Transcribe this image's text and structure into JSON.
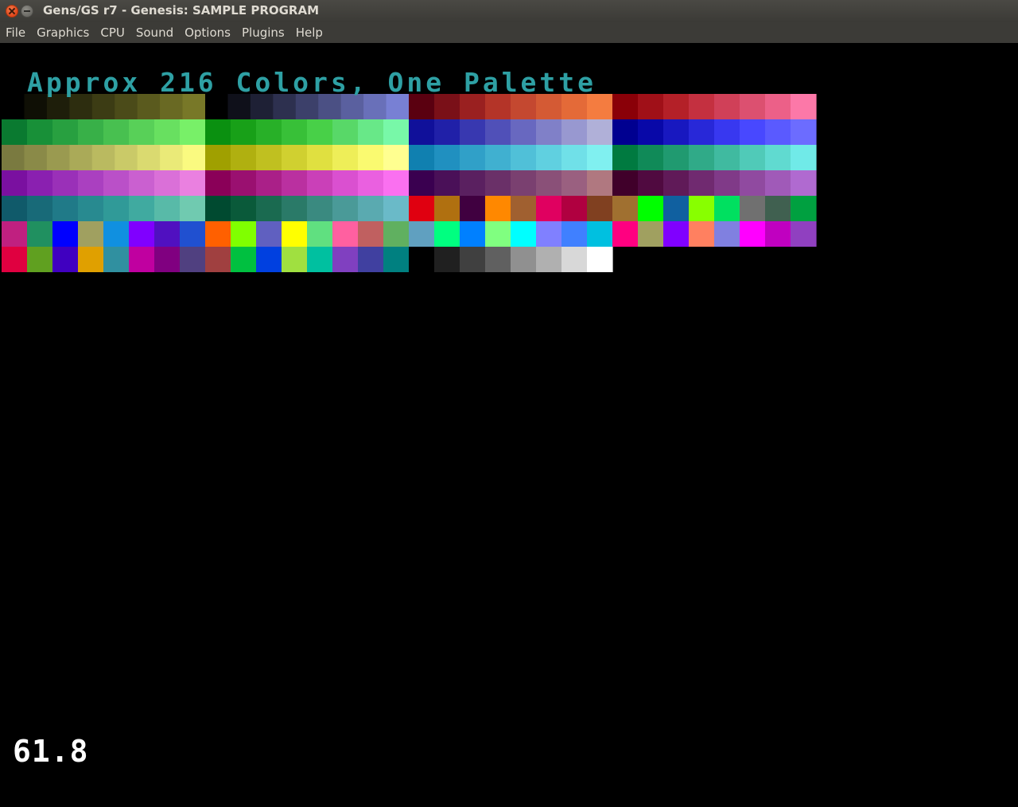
{
  "window": {
    "title": "Gens/GS r7 - Genesis: SAMPLE PROGRAM"
  },
  "menu": {
    "items": [
      "File",
      "Graphics",
      "CPU",
      "Sound",
      "Options",
      "Plugins",
      "Help"
    ]
  },
  "screen": {
    "heading": "Approx 216 Colors, One Palette",
    "fps": "61.8"
  },
  "colors": {
    "heading": "#2ea0a4",
    "background": "#000000",
    "fps": "#ffffff"
  },
  "palette_rows": [
    [
      [
        "#000000",
        "#0f0f05",
        "#1e1e0a",
        "#2d2d0f",
        "#3c3c14",
        "#4b4b19",
        "#5a5a1e",
        "#696923",
        "#787828"
      ],
      [
        "#000000",
        "#0f101a",
        "#1e2035",
        "#2d304f",
        "#3c406a",
        "#4b5084",
        "#5a609f",
        "#6970b9",
        "#7880d4"
      ],
      [
        "#5a0010",
        "#7a1018",
        "#9a2020",
        "#b43428",
        "#c44830",
        "#d45a34",
        "#e46a38",
        "#f47c40"
      ],
      [
        "#8a0008",
        "#a01018",
        "#b42028",
        "#c43040",
        "#d04058",
        "#dc5070",
        "#ec6088",
        "#fc78a8"
      ]
    ],
    [
      [
        "#0a7a30",
        "#189038",
        "#28a040",
        "#38b048",
        "#48c050",
        "#58d058",
        "#68e060",
        "#78f068"
      ],
      [
        "#0a9010",
        "#18a018",
        "#28b028",
        "#38c038",
        "#48d048",
        "#58d868",
        "#68e888",
        "#78f8a8"
      ],
      [
        "#10109a",
        "#2020a8",
        "#3838b0",
        "#5050b8",
        "#6868c0",
        "#8080c8",
        "#9898d0",
        "#b0b0d8"
      ],
      [
        "#000090",
        "#0808a8",
        "#1818c0",
        "#2828d8",
        "#3838f0",
        "#4848ff",
        "#5a5aff",
        "#6c6cff"
      ]
    ],
    [
      [
        "#7a7a40",
        "#8a8a48",
        "#9a9a50",
        "#aaaa58",
        "#baba60",
        "#caca68",
        "#dada70",
        "#eaea78",
        "#fafa80"
      ],
      [
        "#a0a000",
        "#b0b010",
        "#c0c020",
        "#d0d030",
        "#e0e040",
        "#eeee58",
        "#fafa70",
        "#ffff90"
      ],
      [
        "#1080b0",
        "#2090c0",
        "#30a0c8",
        "#40b0d0",
        "#50c0d8",
        "#60d0e0",
        "#70e0e8",
        "#80f0f0"
      ],
      [
        "#007a40",
        "#108a58",
        "#209a70",
        "#30aa88",
        "#40baa0",
        "#50cab8",
        "#60dad0",
        "#70eae8"
      ]
    ],
    [
      [
        "#7a10a0",
        "#8a20b0",
        "#9a30b8",
        "#aa40c0",
        "#ba50c8",
        "#ca60d0",
        "#da70d8",
        "#ea80e0"
      ],
      [
        "#8a0058",
        "#9a1070",
        "#aa2088",
        "#ba30a0",
        "#ca40b8",
        "#da50d0",
        "#ea60e0",
        "#fa70f0"
      ],
      [
        "#3a0050",
        "#4a1058",
        "#5a2060",
        "#6a3068",
        "#7a4070",
        "#8a5078",
        "#9a6080",
        "#b07880"
      ],
      [
        "#40002a",
        "#500a40",
        "#601a58",
        "#702a70",
        "#803a88",
        "#904aa0",
        "#a05ab8",
        "#b06ad0"
      ]
    ],
    [
      [
        "#105a6a",
        "#186a78",
        "#207a88",
        "#288a90",
        "#309a98",
        "#40aaa0",
        "#58baa8",
        "#70cab0"
      ],
      [
        "#004a30",
        "#0a5a3a",
        "#1a6a50",
        "#2a7a68",
        "#3a8a80",
        "#4a9a98",
        "#5aaab0",
        "#6abac8"
      ],
      [
        "#e00010",
        "#b07010",
        "#400040",
        "#ff8800",
        "#a06030",
        "#e00060",
        "#b00040",
        "#804020"
      ],
      [
        "#a07030",
        "#00ff00",
        "#1060a0",
        "#88ff00",
        "#00e060",
        "#707070",
        "#406050",
        "#00a040"
      ]
    ],
    [
      [
        "#c02080",
        "#209060",
        "#0000ff",
        "#a0a060",
        "#1090e0",
        "#8000ff",
        "#5010c0",
        "#2050d0"
      ],
      [
        "#ff6000",
        "#80ff00",
        "#6060c0",
        "#ffff00",
        "#60e080",
        "#ff60a0",
        "#c06060",
        "#60b060"
      ],
      [
        "#60a0c0",
        "#00ff80",
        "#0080ff",
        "#80ff80",
        "#00ffff",
        "#8080ff",
        "#4080ff",
        "#00c0e0"
      ],
      [
        "#ff0080",
        "#a0a060",
        "#8000ff",
        "#ff8060",
        "#8080e0",
        "#ff00ff",
        "#c000c0",
        "#9040c0"
      ]
    ],
    [
      [
        "#e00040",
        "#60a020",
        "#4000c0",
        "#e0a000",
        "#3090a0",
        "#c000a0",
        "#800080",
        "#504080"
      ],
      [
        "#a04040",
        "#00c040",
        "#0040e0",
        "#a0e040",
        "#00c0a0",
        "#8040c0",
        "#4040a0",
        "#008080"
      ],
      [
        "#000000",
        "#202020",
        "#404040",
        "#606060",
        "#909090",
        "#b0b0b0",
        "#d8d8d8",
        "#ffffff"
      ],
      []
    ]
  ]
}
